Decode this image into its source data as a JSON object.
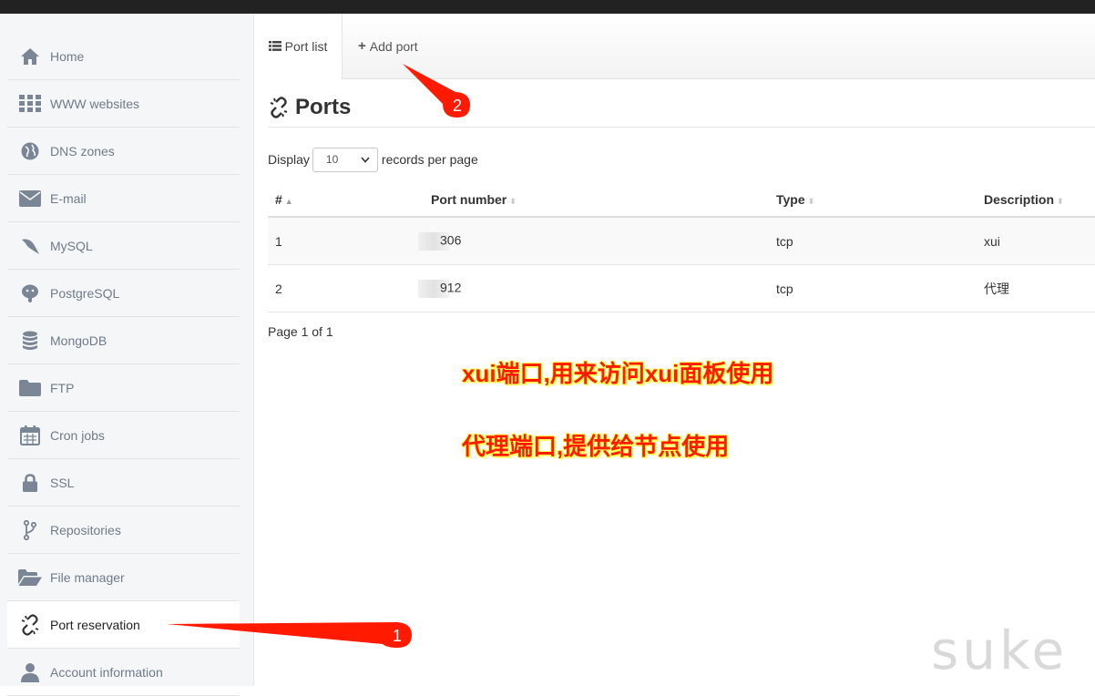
{
  "sidebar": {
    "items": [
      {
        "label": "Home",
        "icon": "home-icon"
      },
      {
        "label": "WWW websites",
        "icon": "grid-icon"
      },
      {
        "label": "DNS zones",
        "icon": "globe-icon"
      },
      {
        "label": "E-mail",
        "icon": "envelope-icon"
      },
      {
        "label": "MySQL",
        "icon": "dolphin-icon"
      },
      {
        "label": "PostgreSQL",
        "icon": "elephant-icon"
      },
      {
        "label": "MongoDB",
        "icon": "database-icon"
      },
      {
        "label": "FTP",
        "icon": "folder-icon"
      },
      {
        "label": "Cron jobs",
        "icon": "calendar-icon"
      },
      {
        "label": "SSL",
        "icon": "lock-icon"
      },
      {
        "label": "Repositories",
        "icon": "branch-icon"
      },
      {
        "label": "File manager",
        "icon": "folder-open-icon"
      },
      {
        "label": "Port reservation",
        "icon": "broken-link-icon",
        "active": true
      },
      {
        "label": "Account information",
        "icon": "user-icon"
      }
    ]
  },
  "tabs": {
    "port_list": "Port list",
    "add_port": "Add port"
  },
  "page": {
    "title": "Ports"
  },
  "length_control": {
    "prefix": "Display",
    "value": "10",
    "suffix": "records per page"
  },
  "table": {
    "columns": [
      "#",
      "Port number",
      "Type",
      "Description"
    ],
    "rows": [
      {
        "num": "1",
        "port": "306",
        "type": "tcp",
        "description": "xui"
      },
      {
        "num": "2",
        "port": "912",
        "type": "tcp",
        "description": "代理"
      }
    ]
  },
  "pager": "Page 1 of 1",
  "annotations": {
    "note1": "xui端口,用来访问xui面板使用",
    "note2": "代理端口,提供给节点使用",
    "marker1": "1",
    "marker2": "2",
    "color": "#ff1a00"
  },
  "watermark": "suke"
}
